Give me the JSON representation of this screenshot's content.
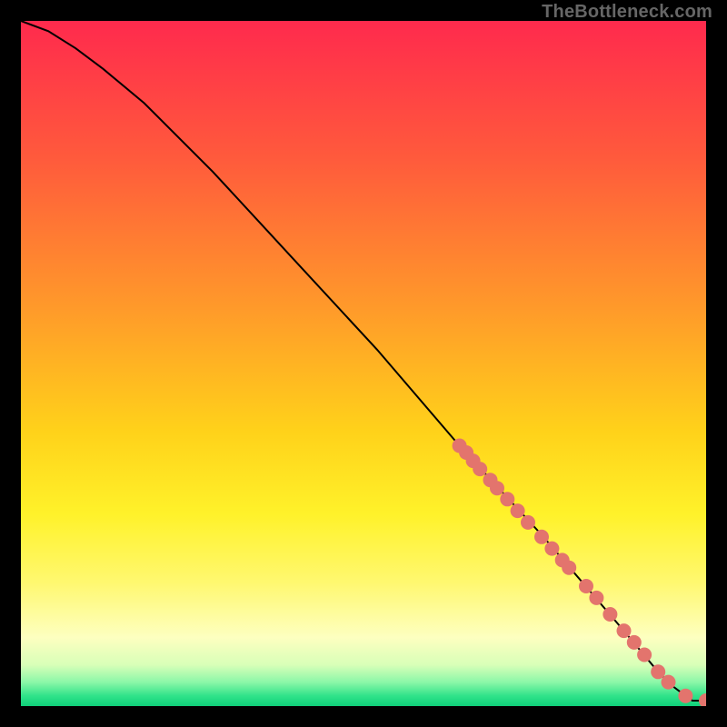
{
  "watermark": "TheBottleneck.com",
  "chart_data": {
    "type": "line",
    "title": "",
    "xlabel": "",
    "ylabel": "",
    "xlim": [
      0,
      100
    ],
    "ylim": [
      0,
      100
    ],
    "grid": false,
    "series": [
      {
        "name": "curve",
        "x": [
          0,
          4,
          8,
          12,
          18,
          28,
          40,
          52,
          64,
          76,
          88,
          93,
          95,
          97,
          98,
          100
        ],
        "y": [
          100,
          98.5,
          96,
          93,
          88,
          78,
          65,
          52,
          38,
          25,
          11,
          5,
          3,
          1.5,
          0.8,
          0.8
        ]
      }
    ],
    "points": {
      "name": "markers",
      "xy": [
        [
          64,
          38
        ],
        [
          65,
          37
        ],
        [
          66,
          35.8
        ],
        [
          67,
          34.6
        ],
        [
          68.5,
          33
        ],
        [
          69.5,
          31.8
        ],
        [
          71,
          30.2
        ],
        [
          72.5,
          28.5
        ],
        [
          74,
          26.8
        ],
        [
          76,
          24.7
        ],
        [
          77.5,
          23
        ],
        [
          79,
          21.3
        ],
        [
          80,
          20.2
        ],
        [
          82.5,
          17.5
        ],
        [
          84,
          15.8
        ],
        [
          86,
          13.4
        ],
        [
          88,
          11
        ],
        [
          89.5,
          9.3
        ],
        [
          91,
          7.5
        ],
        [
          93,
          5
        ],
        [
          94.5,
          3.5
        ],
        [
          97,
          1.5
        ],
        [
          100,
          0.8
        ],
        [
          101,
          0.8
        ]
      ]
    },
    "gradient_stops": [
      {
        "offset": 0.0,
        "color": "#ff2a4d"
      },
      {
        "offset": 0.2,
        "color": "#ff5a3c"
      },
      {
        "offset": 0.42,
        "color": "#ff9a2a"
      },
      {
        "offset": 0.6,
        "color": "#ffd21a"
      },
      {
        "offset": 0.72,
        "color": "#fff22a"
      },
      {
        "offset": 0.82,
        "color": "#fff870"
      },
      {
        "offset": 0.9,
        "color": "#fdffc0"
      },
      {
        "offset": 0.94,
        "color": "#d8ffb8"
      },
      {
        "offset": 0.965,
        "color": "#8cf7a8"
      },
      {
        "offset": 0.985,
        "color": "#30e38a"
      },
      {
        "offset": 1.0,
        "color": "#0fd07a"
      }
    ],
    "line_color": "#000000",
    "marker_color": "#e3746d"
  }
}
